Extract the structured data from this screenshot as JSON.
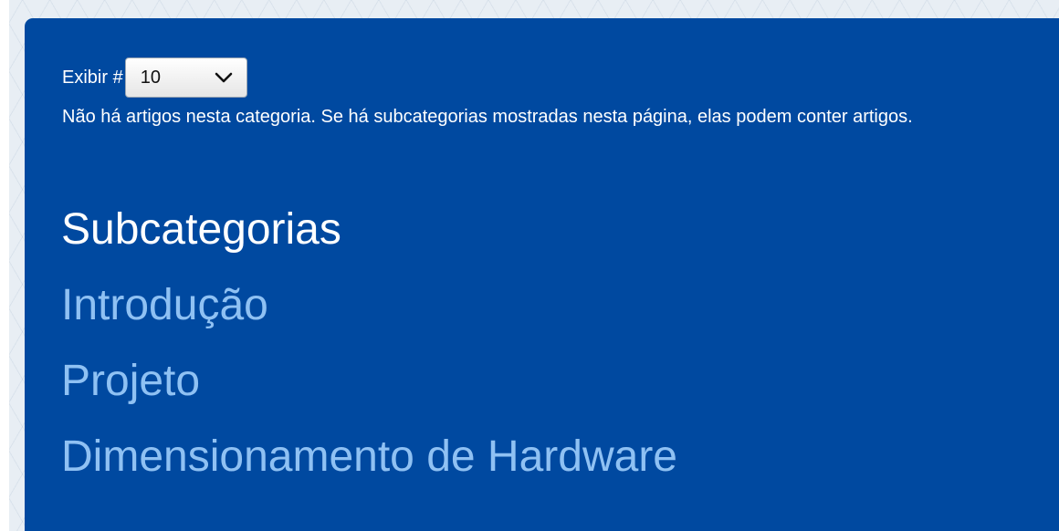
{
  "display": {
    "label": "Exibir #",
    "selected_value": "10"
  },
  "notice_text": "Não há artigos nesta categoria. Se há subcategorias mostradas nesta página, elas podem conter artigos.",
  "subcategories": {
    "heading": "Subcategorias",
    "items": [
      {
        "label": "Introdução"
      },
      {
        "label": "Projeto"
      },
      {
        "label": "Dimensionamento de Hardware"
      }
    ]
  }
}
